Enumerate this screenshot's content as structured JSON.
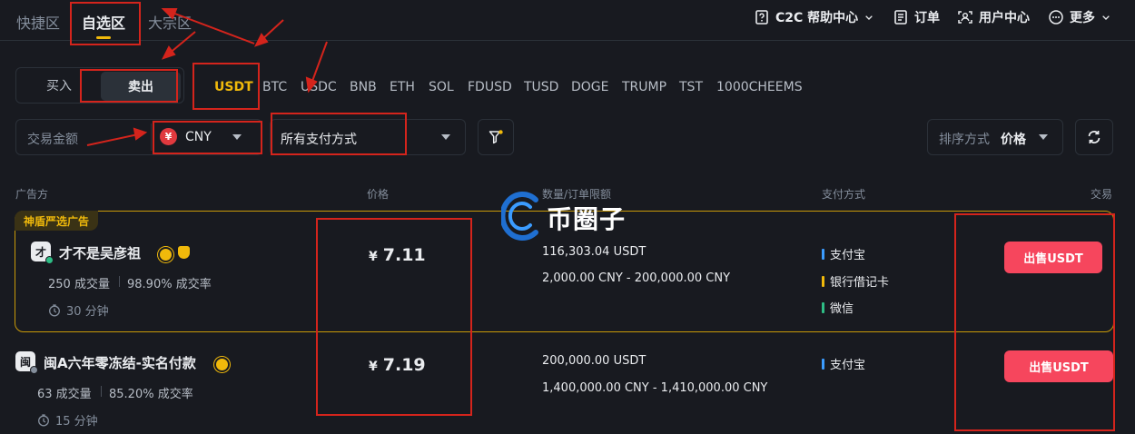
{
  "top_nav": {
    "zones": [
      {
        "label": "快捷区"
      },
      {
        "label": "自选区"
      },
      {
        "label": "大宗区"
      }
    ],
    "help": "C2C 帮助中心",
    "orders": "订单",
    "user_center": "用户中心",
    "more": "更多"
  },
  "trade_toggle": {
    "buy": "买入",
    "sell": "卖出"
  },
  "coins": [
    "USDT",
    "BTC",
    "USDC",
    "BNB",
    "ETH",
    "SOL",
    "FDUSD",
    "TUSD",
    "DOGE",
    "TRUMP",
    "TST",
    "1000CHEEMS"
  ],
  "filters": {
    "amount_label": "交易金额",
    "currency_symbol": "¥",
    "currency": "CNY",
    "payment": "所有支付方式",
    "sort_label": "排序方式",
    "sort_value": "价格"
  },
  "table_headers": {
    "advertiser": "广告方",
    "price": "价格",
    "limit": "数量/订单限额",
    "payment": "支付方式",
    "trade": "交易"
  },
  "watermark": "币圈子",
  "ads": [
    {
      "tag": "神盾严选广告",
      "avatar": "才",
      "name": "才不是吴彦祖",
      "orders": "250 成交量",
      "rate": "98.90% 成交率",
      "time": "30 分钟",
      "currency": "¥",
      "price": "7.11",
      "quantity": "116,303.04 USDT",
      "limit": "2,000.00 CNY - 200,000.00 CNY",
      "payments": [
        {
          "name": "支付宝",
          "color": "#3b9cff"
        },
        {
          "name": "银行借记卡",
          "color": "#f0b90b"
        },
        {
          "name": "微信",
          "color": "#2ebd85"
        }
      ],
      "button": "出售USDT"
    },
    {
      "avatar": "闽",
      "name": "闽A六年零冻结-实名付款",
      "orders": "63 成交量",
      "rate": "85.20% 成交率",
      "time": "15 分钟",
      "currency": "¥",
      "price": "7.19",
      "quantity": "200,000.00 USDT",
      "limit": "1,400,000.00 CNY - 1,410,000.00 CNY",
      "payments": [
        {
          "name": "支付宝",
          "color": "#3b9cff"
        }
      ],
      "button": "出售USDT"
    }
  ],
  "colors": {
    "background": "#181a20",
    "accent": "#f0b90b",
    "sell": "#f6465d",
    "annotation": "#d4241c"
  }
}
